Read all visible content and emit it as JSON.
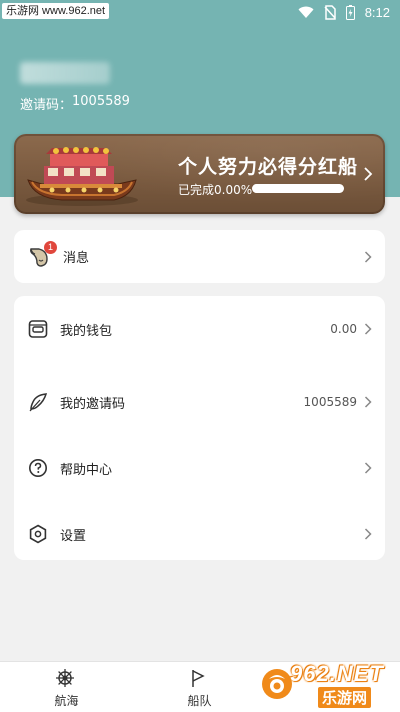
{
  "status_bar": {
    "watermark_text": "乐游网 www.962.net",
    "time": "8:12"
  },
  "profile": {
    "invite_label": "邀请码：",
    "invite_code": "1005589"
  },
  "banner": {
    "title": "个人努力必得分红船",
    "progress_label": "已完成0.00%",
    "progress_fraction": 0.0
  },
  "messages": {
    "label": "消息",
    "badge": "1"
  },
  "menu": {
    "items": [
      {
        "label": "我的钱包",
        "value": "0.00",
        "icon": "wallet-icon"
      },
      {
        "label": "我的邀请码",
        "value": "1005589",
        "icon": "feather-icon"
      },
      {
        "label": "帮助中心",
        "value": "",
        "icon": "help-icon"
      },
      {
        "label": "设置",
        "value": "",
        "icon": "settings-icon"
      }
    ]
  },
  "bottom_nav": {
    "items": [
      {
        "label": "航海",
        "icon": "ship-wheel-icon"
      },
      {
        "label": "船队",
        "icon": "flag-icon"
      }
    ]
  },
  "watermark": {
    "text1": "962.NET",
    "text2": "乐游网"
  },
  "colors": {
    "header": "#75b4b2",
    "banner": "#7a5a3f",
    "badge": "#e0473d",
    "background": "#f1f1f1"
  }
}
